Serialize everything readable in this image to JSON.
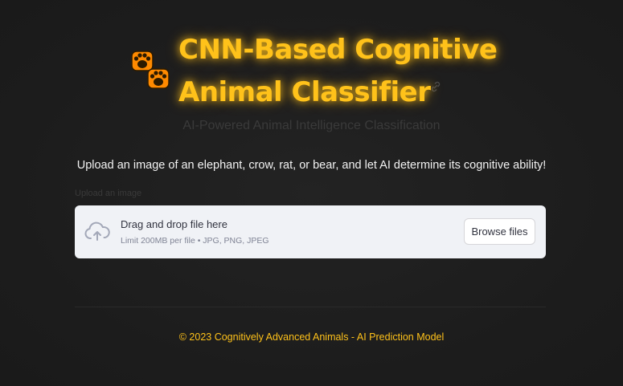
{
  "header": {
    "icon": "paw-prints-icon",
    "title_line1": "CNN-Based Cognitive",
    "title_line2": "Animal Classifier",
    "anchor_icon": "link-icon"
  },
  "subtitle": "AI-Powered Animal Intelligence Classification",
  "intro": "Upload an image of an elephant, crow, rat, or bear, and let AI determine its cognitive ability!",
  "uploader": {
    "label": "Upload an image",
    "dropzone_title": "Drag and drop file here",
    "dropzone_limit": "Limit 200MB per file • JPG, PNG, JPEG",
    "browse_label": "Browse files",
    "icon": "cloud-upload-icon"
  },
  "footer": "© 2023 Cognitively Advanced Animals - AI Prediction Model",
  "colors": {
    "accent": "#ffc21a",
    "background": "#1f1f1f",
    "dropzone": "#f0f2f6",
    "paw_orange": "#ff8a00"
  }
}
